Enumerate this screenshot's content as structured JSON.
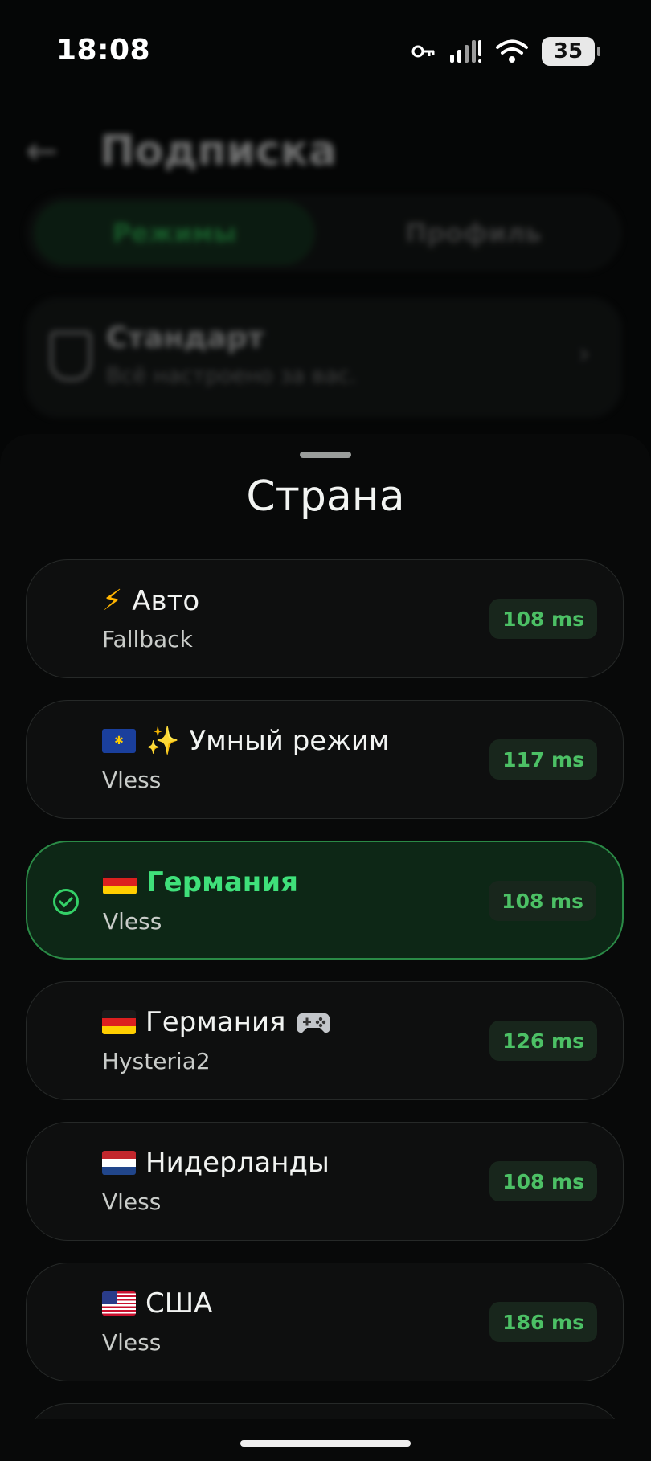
{
  "status_bar": {
    "time": "18:08",
    "battery": "35"
  },
  "background": {
    "title": "Подписка",
    "tabs": [
      "Режимы",
      "Профиль"
    ],
    "card": {
      "title": "Стандарт",
      "subtitle": "Всё настроено за вас."
    }
  },
  "sheet": {
    "title": "Страна",
    "items": [
      {
        "name": "Авто",
        "protocol": "Fallback",
        "ping": "108 ms",
        "selected": false
      },
      {
        "name": "Умный режим",
        "protocol": "Vless",
        "ping": "117 ms",
        "selected": false
      },
      {
        "name": "Германия",
        "protocol": "Vless",
        "ping": "108 ms",
        "selected": true
      },
      {
        "name": "Германия",
        "protocol": "Hysteria2",
        "ping": "126 ms",
        "selected": false
      },
      {
        "name": "Нидерланды",
        "protocol": "Vless",
        "ping": "108 ms",
        "selected": false
      },
      {
        "name": "США",
        "protocol": "Vless",
        "ping": "186 ms",
        "selected": false
      }
    ]
  },
  "colors": {
    "accent": "#3fe07a",
    "ping_text": "#4cc065",
    "selected_bg": "#0d2716"
  }
}
